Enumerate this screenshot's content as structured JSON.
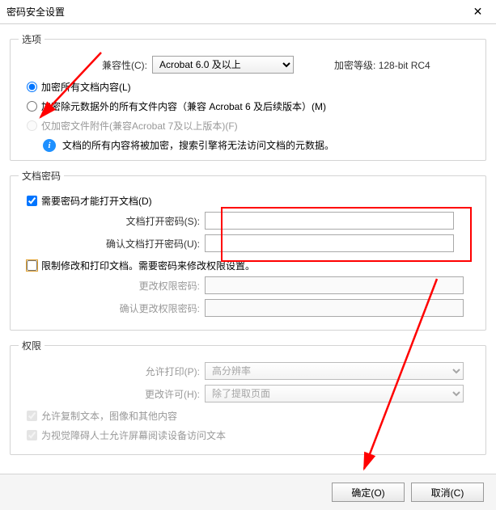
{
  "titlebar": {
    "title": "密码安全设置",
    "close": "✕"
  },
  "options": {
    "legend": "选项",
    "compat_label": "兼容性(C):",
    "compat_value": "Acrobat 6.0 及以上",
    "enc_level_label": "加密等级:",
    "enc_level_value": "128-bit RC4",
    "radio1": "加密所有文档内容(L)",
    "radio2": "加密除元数据外的所有文件内容（兼容 Acrobat 6 及后续版本）(M)",
    "radio3": "仅加密文件附件(兼容Acrobat 7及以上版本)(F)",
    "info": "文档的所有内容将被加密，搜索引擎将无法访问文档的元数据。"
  },
  "doc_pwd": {
    "legend": "文档密码",
    "require": "需要密码才能打开文档(D)",
    "open_label": "文档打开密码(S):",
    "confirm_label": "确认文档打开密码(U):",
    "restrict": "限制修改和打印文档。需要密码来修改权限设置。",
    "change_pwd_label": "更改权限密码:",
    "confirm_change_label": "确认更改权限密码:"
  },
  "perms": {
    "legend": "权限",
    "print_label": "允许打印(P):",
    "print_value": "高分辨率",
    "change_label": "更改许可(H):",
    "change_value": "除了提取页面",
    "allow_copy": "允许复制文本，图像和其他内容",
    "allow_screen": "为视觉障碍人士允许屏幕阅读设备访问文本"
  },
  "buttons": {
    "ok": "确定(O)",
    "cancel": "取消(C)"
  }
}
